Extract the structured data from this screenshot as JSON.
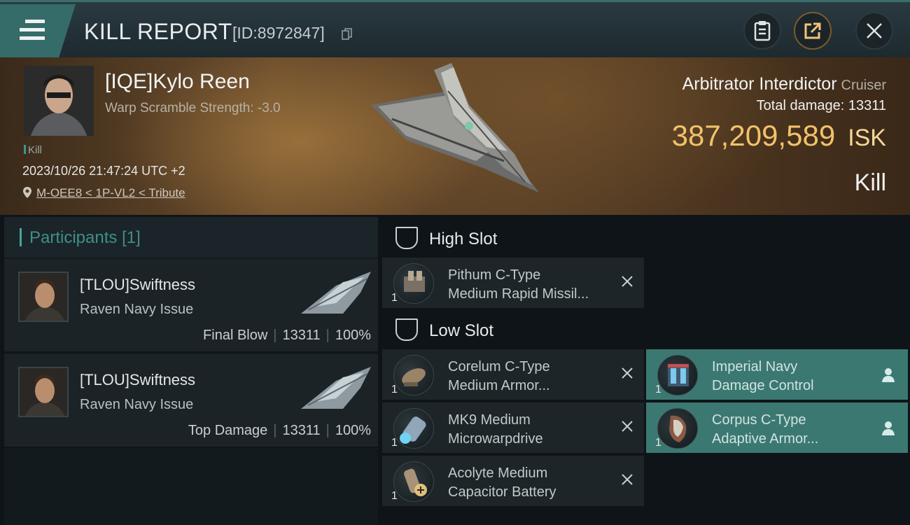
{
  "header": {
    "title": "KILL REPORT",
    "report_id": "[ID:8972847]"
  },
  "victim": {
    "name": "[IQE]Kylo Reen",
    "stat": "Warp Scramble Strength: -3.0",
    "tag": "Kill",
    "datetime": "2023/10/26 21:47:24 UTC +2",
    "location": "M-OEE8 < 1P-VL2 < Tribute",
    "ship": "Arbitrator Interdictor",
    "ship_class": "Cruiser",
    "total_damage_label": "Total damage:",
    "total_damage": "13311",
    "isk_value": "387,209,589",
    "isk_unit": "ISK",
    "result": "Kill"
  },
  "participants": {
    "label": "Participants",
    "count": "[1]",
    "items": [
      {
        "name": "[TLOU]Swiftness",
        "ship": "Raven Navy Issue",
        "role": "Final Blow",
        "damage": "13311",
        "percent": "100%"
      },
      {
        "name": "[TLOU]Swiftness",
        "ship": "Raven Navy Issue",
        "role": "Top Damage",
        "damage": "13311",
        "percent": "100%"
      }
    ],
    "separator": "|"
  },
  "fitting": {
    "high_slot_label": "High Slot",
    "low_slot_label": "Low Slot",
    "high": [
      {
        "qty": "1",
        "line1": "Pithum C-Type",
        "line2": "Medium Rapid Missil..."
      }
    ],
    "low": [
      {
        "qty": "1",
        "line1": "Corelum C-Type",
        "line2": "Medium Armor..."
      },
      {
        "qty": "1",
        "line1": "MK9 Medium",
        "line2": "Microwarpdrive"
      },
      {
        "qty": "1",
        "line1": "Acolyte Medium",
        "line2": "Capacitor Battery"
      }
    ],
    "low_fitted": [
      {
        "qty": "1",
        "line1": "Imperial Navy",
        "line2": "Damage Control"
      },
      {
        "qty": "1",
        "line1": "Corpus C-Type",
        "line2": "Adaptive Armor..."
      }
    ]
  },
  "colors": {
    "accent_teal": "#3c7872",
    "isk_gold": "#f2c26a",
    "header_tab": "#356b68"
  },
  "icons": [
    "menu-icon",
    "copy-icon",
    "clipboard-icon",
    "share-icon",
    "close-icon",
    "location-pin-icon",
    "slot-icon",
    "remove-icon",
    "user-icon"
  ]
}
